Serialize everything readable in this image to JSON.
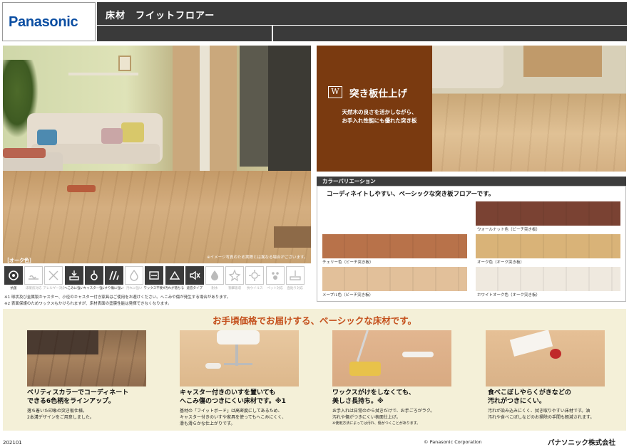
{
  "header": {
    "logo": "Panasonic",
    "title": "床材　フイットフロアー"
  },
  "room_photo": {
    "tag": "［オーク色］",
    "note": "※イメージ写真のため実際とは異なる場合がございます。"
  },
  "features": [
    {
      "label": "抗菌",
      "active": true,
      "icon": "antibacterial-icon"
    },
    {
      "label": "床暖房対応",
      "active": false,
      "icon": "floor-heating-icon"
    },
    {
      "label": "アレルギー対応",
      "active": false,
      "icon": "allergy-icon"
    },
    {
      "label": "へこみに強い",
      "active": true,
      "icon": "dent-resistant-icon"
    },
    {
      "label": "キャスター強い※1",
      "active": true,
      "icon": "caster-icon"
    },
    {
      "label": "すり傷に強い",
      "active": true,
      "icon": "scratch-resistant-icon"
    },
    {
      "label": "汚れに強い",
      "active": false,
      "icon": "stain-icon"
    },
    {
      "label": "ワックス不要※2",
      "active": true,
      "icon": "wax-free-icon"
    },
    {
      "label": "汚れが落ちる",
      "active": true,
      "icon": "easy-clean-icon"
    },
    {
      "label": "遮音タイプ",
      "active": true,
      "icon": "sound-insulation-icon"
    },
    {
      "label": "耐水",
      "active": false,
      "icon": "water-resistant-icon"
    },
    {
      "label": "衝撃吸収",
      "active": false,
      "icon": "impact-icon"
    },
    {
      "label": "抗ウイルス",
      "active": false,
      "icon": "antiviral-icon"
    },
    {
      "label": "ペット対応",
      "active": false,
      "icon": "pet-icon"
    },
    {
      "label": "直貼り対応",
      "active": false,
      "icon": "direct-install-icon"
    }
  ],
  "feature_notes": [
    "※1 球状及び金属製キャスター、小径のキャスター付き家具はご使用をお避けください。へこみや傷が発生する場合があります。",
    "※2 表面保護のためワックスもかけられますが、床材表面の塗膜性能は発揮できなくなります。"
  ],
  "w_panel": {
    "badge": "W",
    "title": "突き板仕上げ",
    "desc_1": "天然木の良さを活かしながら、",
    "desc_2": "お手入れ性能にも優れた突き板"
  },
  "color_variation": {
    "label": "カラーバリエーション",
    "lead": "コーディネイトしやすい、ベーシックな突き板フロアーです。",
    "swatches": [
      {
        "name": "ウォールナット色（ビーチ突き板）",
        "color": "#7a4233"
      },
      {
        "name": "チェリー色（ビーチ突き板）",
        "color": "#b8724a"
      },
      {
        "name": "オーク色（オーク突き板）",
        "color": "#d9b378"
      },
      {
        "name": "メープル色（ビーチ突き板）",
        "color": "#e2c09a"
      },
      {
        "name": "ホワイトオーク色（オーク突き板）",
        "color": "#efe9df"
      }
    ]
  },
  "bottom": {
    "headline": "お手頃価格でお届けする、ベーシックな床材です。",
    "features": [
      {
        "title_1": "ベリティスカラーでコーディネート",
        "title_2": "できる6色柄をラインアップ。",
        "desc_1": "落ち着いた印象の突き板仕様。",
        "desc_2": "2本溝デザインをご用意しました。",
        "desc_3": ""
      },
      {
        "title_1": "キャスター付きのいすを置いても",
        "title_2": "へこみ傷のつきにくい床材です。※1",
        "desc_1": "基材の「フイットボード」は高密度にしてあるため、",
        "desc_2": "キャスター付きのいすや家具を使ってもへこみにくく、",
        "desc_3": "滑も滑らかな仕上がりです。"
      },
      {
        "title_1": "ワックスがけをしなくても、",
        "title_2": "美しさ長持ち。※",
        "desc_1": "お手入れは日常のから拭きだけで、お手ごろがラク。",
        "desc_2": "汚れや傷がつきにくい表面仕上げ。",
        "desc_3": "※使用方法によっては汚れ、傷がつくことがあります。"
      },
      {
        "title_1": "食べこぼしやらくがきなどの",
        "title_2": "汚れがつきにくい。",
        "desc_1": "汚れが染み込みにくく、拭き取りやすい床材です。油",
        "desc_2": "汚れや食べこぼしなどのお掃除の手間も軽減されます。",
        "desc_3": ""
      }
    ]
  },
  "footer": {
    "code": "202101",
    "copyright": "© Panasonic Corporation",
    "company": "パナソニック株式会社"
  },
  "colors": {
    "brand": "#0b4ea2",
    "header_bg": "#3a3a3a",
    "w_panel_bg": "#7a3a10",
    "headline": "#c4501c",
    "bottom_bg": "#f4f0d8"
  }
}
